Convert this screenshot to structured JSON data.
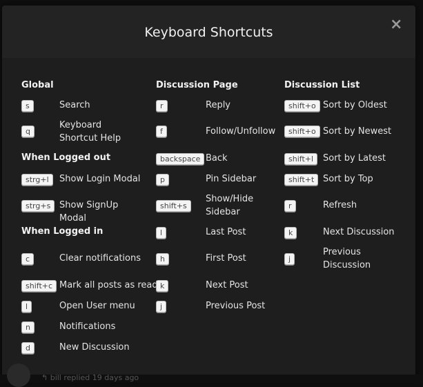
{
  "modal": {
    "title": "Keyboard Shortcuts",
    "close_label": "×"
  },
  "columns": [
    {
      "sections": [
        {
          "heading": "Global",
          "items": [
            {
              "key": "s",
              "desc": "Search"
            },
            {
              "key": "q",
              "desc": "Keyboard Shortcut Help"
            }
          ]
        },
        {
          "heading": "When Logged out",
          "items": [
            {
              "key": "strg+l",
              "desc": "Show Login Modal"
            },
            {
              "key": "strg+s",
              "desc": "Show SignUp Modal"
            }
          ]
        },
        {
          "heading": "When Logged in",
          "items": [
            {
              "key": "c",
              "desc": "Clear notifications"
            },
            {
              "key": "shift+c",
              "desc": "Mark all posts as read"
            },
            {
              "key": "l",
              "desc": "Open User menu"
            },
            {
              "key": "n",
              "desc": "Notifications"
            },
            {
              "key": "d",
              "desc": "New Discussion"
            }
          ]
        }
      ]
    },
    {
      "sections": [
        {
          "heading": "Discussion Page",
          "items": [
            {
              "key": "r",
              "desc": "Reply"
            },
            {
              "key": "f",
              "desc": "Follow/Unfollow"
            },
            {
              "key": "backspace",
              "desc": "Back"
            },
            {
              "key": "p",
              "desc": "Pin Sidebar"
            },
            {
              "key": "shift+s",
              "desc": "Show/Hide Sidebar"
            },
            {
              "key": "l",
              "desc": "Last Post"
            },
            {
              "key": "h",
              "desc": "First Post"
            },
            {
              "key": "k",
              "desc": "Next Post"
            },
            {
              "key": "j",
              "desc": "Previous Post"
            }
          ]
        }
      ]
    },
    {
      "sections": [
        {
          "heading": "Discussion List",
          "items": [
            {
              "key": "shift+o",
              "desc": "Sort by Oldest"
            },
            {
              "key": "shift+o",
              "desc": "Sort by Newest"
            },
            {
              "key": "shift+l",
              "desc": "Sort by Latest"
            },
            {
              "key": "shift+t",
              "desc": "Sort by Top"
            },
            {
              "key": "r",
              "desc": "Refresh"
            },
            {
              "key": "k",
              "desc": "Next Discussion"
            },
            {
              "key": "j",
              "desc": "Previous Discussion"
            }
          ]
        }
      ]
    }
  ],
  "background": {
    "partial_text": "↰ bill replied 19 days ago"
  }
}
